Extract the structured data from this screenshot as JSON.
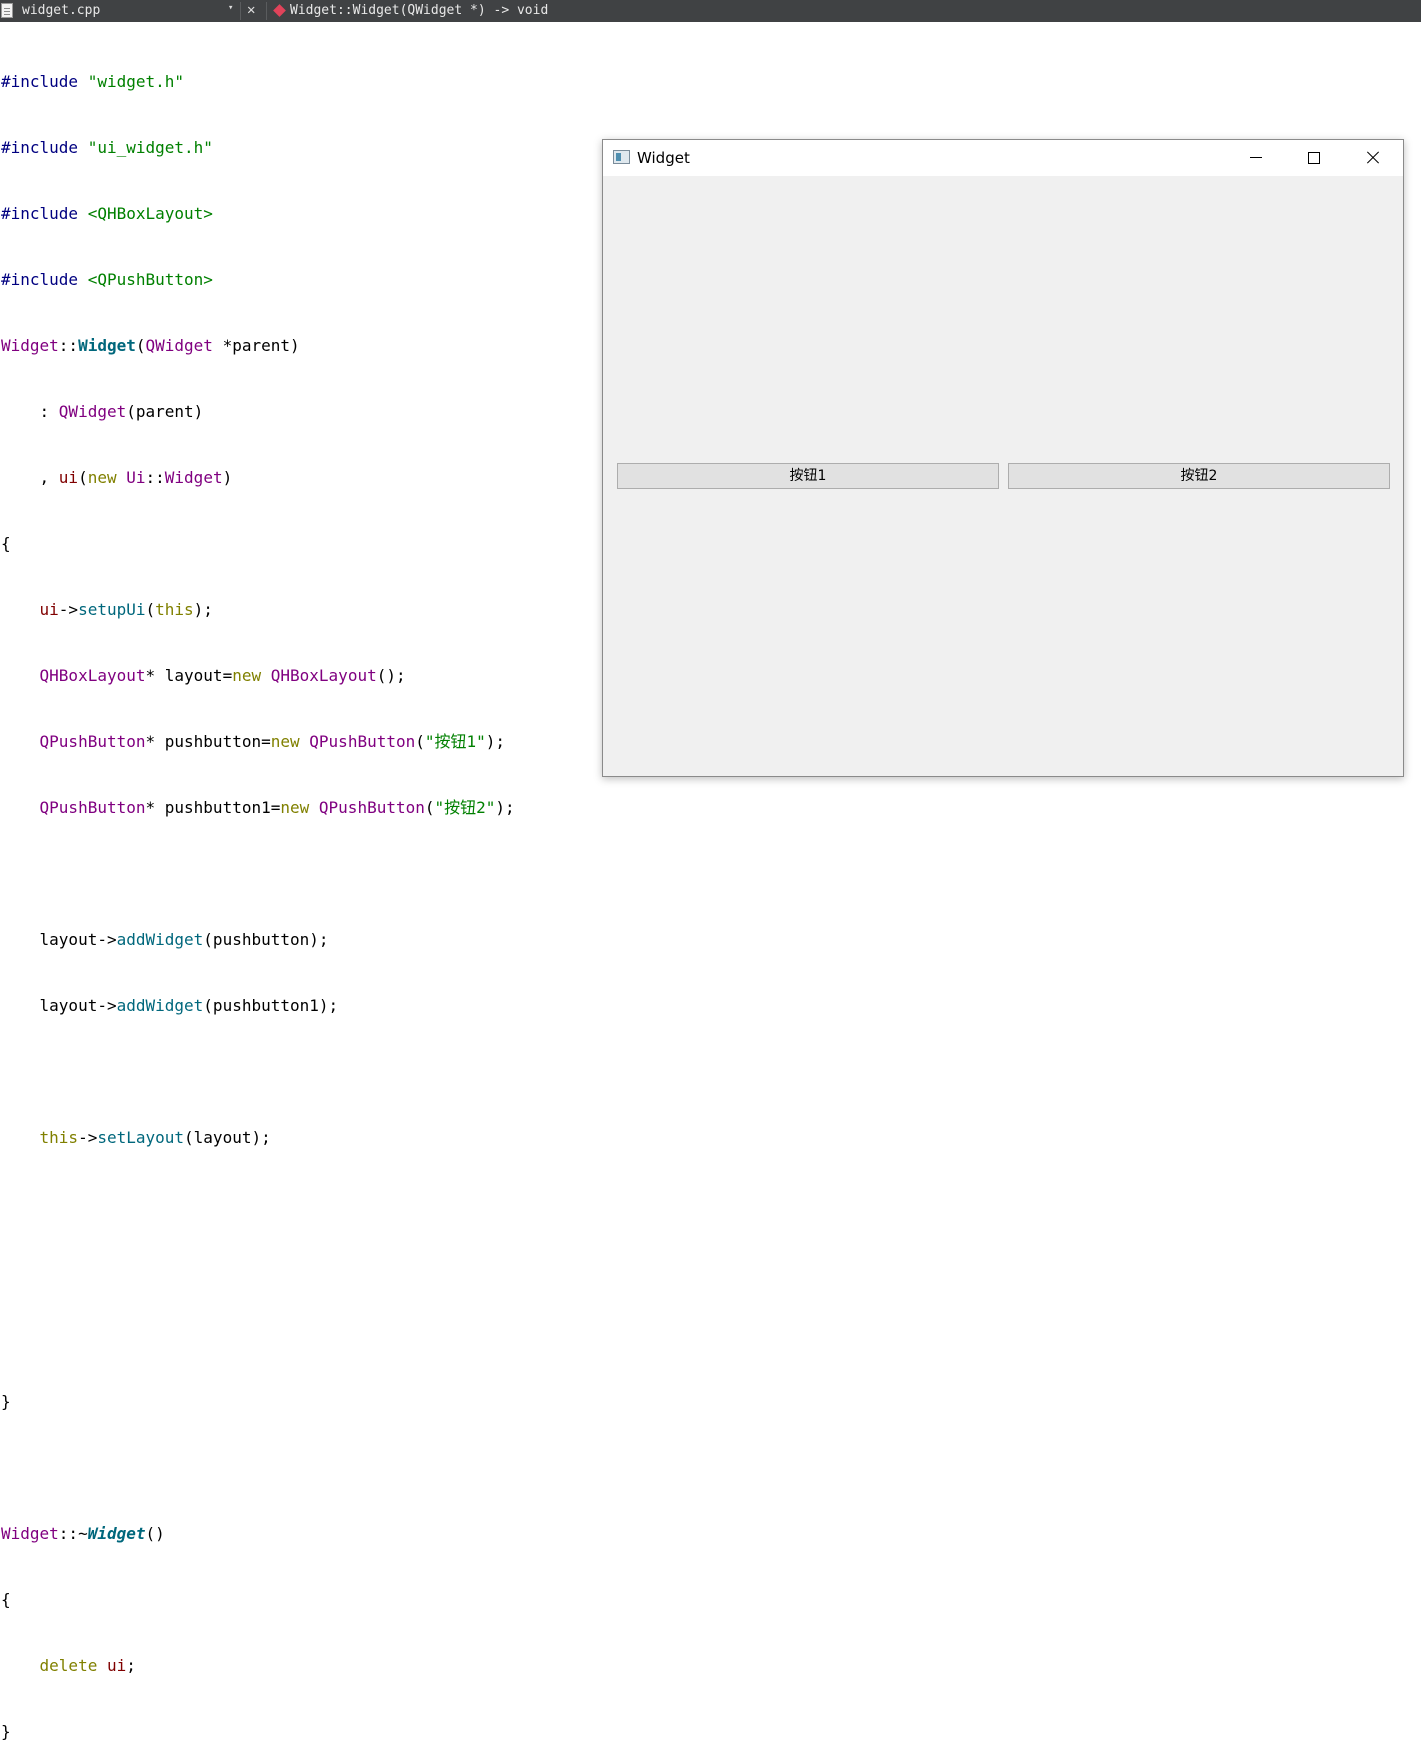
{
  "editor": {
    "file_name": "widget.cpp",
    "dropdown_glyph": "▾",
    "close_glyph": "✕",
    "symbol": "Widget::Widget(QWidget *) -> void"
  },
  "code_lines": [
    "#include \"widget.h\"",
    "#include \"ui_widget.h\"",
    "#include <QHBoxLayout>",
    "#include <QPushButton>",
    "Widget::Widget(QWidget *parent)",
    "    : QWidget(parent)",
    "    , ui(new Ui::Widget)",
    "{",
    "    ui->setupUi(this);",
    "    QHBoxLayout* layout=new QHBoxLayout();",
    "    QPushButton* pushbutton=new QPushButton(\"按钮1\");",
    "    QPushButton* pushbutton1=new QPushButton(\"按钮2\");",
    "",
    "    layout->addWidget(pushbutton);",
    "    layout->addWidget(pushbutton1);",
    "",
    "    this->setLayout(layout);",
    "",
    "",
    "",
    "}",
    "",
    "Widget::~Widget()",
    "{",
    "    delete ui;",
    "}"
  ],
  "window": {
    "title": "Widget",
    "button1": "按钮1",
    "button2": "按钮2"
  }
}
